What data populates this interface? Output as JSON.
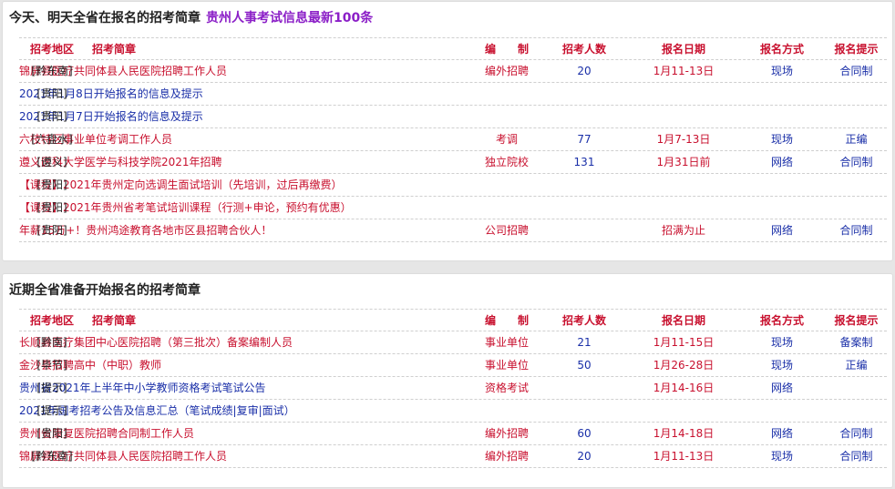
{
  "section1": {
    "title": "今天、明天全省在报名的招考简章",
    "link": "贵州人事考试信息最新100条",
    "headers": {
      "region": "招考地区",
      "title": "招考简章",
      "type": "编　　制",
      "num": "招考人数",
      "date": "报名日期",
      "method": "报名方式",
      "note": "报名提示"
    },
    "rows": [
      {
        "region": "[黔东南]",
        "title": "锦屏县医疗共同体县人民医院招聘工作人员",
        "type": "编外招聘",
        "num": "20",
        "date": "1月11-13日",
        "method": "现场",
        "note": "合同制",
        "color": "#c8102e"
      },
      {
        "region": "[贵阳]",
        "title": "2021年1月8日开始报名的信息及提示",
        "type": "",
        "num": "",
        "date": "",
        "method": "",
        "note": "",
        "color": "#1a2fa8"
      },
      {
        "region": "[贵阳]",
        "title": "2021年1月7日开始报名的信息及提示",
        "type": "",
        "num": "",
        "date": "",
        "method": "",
        "note": "",
        "color": "#1a2fa8"
      },
      {
        "region": "[六盘水]",
        "title": "六枝特区事业单位考调工作人员",
        "type": "考调",
        "num": "77",
        "date": "1月7-13日",
        "method": "现场",
        "note": "正编",
        "color": "#c8102e"
      },
      {
        "region": "[遵义]",
        "title": "遵义医科大学医学与科技学院2021年招聘",
        "type": "独立院校",
        "num": "131",
        "date": "1月31日前",
        "method": "网络",
        "note": "合同制",
        "color": "#c8102e"
      },
      {
        "region": "[贵阳]",
        "title": "【课程】2021年贵州定向选调生面试培训（先培训，过后再缴费）",
        "type": "",
        "num": "",
        "date": "",
        "method": "",
        "note": "",
        "color": "#c8102e"
      },
      {
        "region": "[贵阳]",
        "title": "【课程】2021年贵州省考笔试培训课程（行测+申论，预约有优惠）",
        "type": "",
        "num": "",
        "date": "",
        "method": "",
        "note": "",
        "color": "#c8102e"
      },
      {
        "region": "[贵阳]",
        "title": "年薪15万+！贵州鸿途教育各地市区县招聘合伙人！",
        "type": "公司招聘",
        "num": "",
        "date": "招满为止",
        "method": "网络",
        "note": "合同制",
        "color": "#c8102e"
      }
    ]
  },
  "section2": {
    "title": "近期全省准备开始报名的招考简章",
    "headers": {
      "region": "招考地区",
      "title": "招考简章",
      "type": "编　　制",
      "num": "招考人数",
      "date": "报名日期",
      "method": "报名方式",
      "note": "报名提示"
    },
    "rows": [
      {
        "region": "[黔南]",
        "title": "长顺县医疗集团中心医院招聘（第三批次）备案编制人员",
        "type": "事业单位",
        "num": "21",
        "date": "1月11-15日",
        "method": "现场",
        "note": "备案制",
        "color": "#c8102e"
      },
      {
        "region": "[毕节]",
        "title": "金沙县招聘高中（中职）教师",
        "type": "事业单位",
        "num": "50",
        "date": "1月26-28日",
        "method": "现场",
        "note": "正编",
        "color": "#c8102e"
      },
      {
        "region": "[提示]",
        "title": "贵州省2021年上半年中小学教师资格考试笔试公告",
        "type": "资格考试",
        "num": "",
        "date": "1月14-16日",
        "method": "网络",
        "note": "",
        "color": "#1a2fa8"
      },
      {
        "region": "[提示]",
        "title": "2021年国考招考公告及信息汇总（笔试成绩|复审|面试）",
        "type": "",
        "num": "",
        "date": "",
        "method": "",
        "note": "",
        "color": "#1a2fa8"
      },
      {
        "region": "[贵阳]",
        "title": "贵州省康复医院招聘合同制工作人员",
        "type": "编外招聘",
        "num": "60",
        "date": "1月14-18日",
        "method": "网络",
        "note": "合同制",
        "color": "#c8102e"
      },
      {
        "region": "[黔东南]",
        "title": "锦屏县医疗共同体县人民医院招聘工作人员",
        "type": "编外招聘",
        "num": "20",
        "date": "1月11-13日",
        "method": "现场",
        "note": "合同制",
        "color": "#c8102e"
      }
    ]
  }
}
